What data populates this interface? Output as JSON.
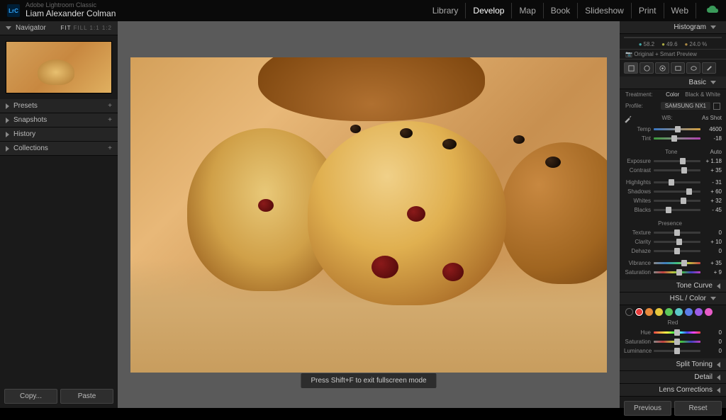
{
  "header": {
    "app_name": "Adobe Lightroom Classic",
    "user_name": "Liam Alexander Colman",
    "logo_text": "LrC",
    "modules": [
      "Library",
      "Develop",
      "Map",
      "Book",
      "Slideshow",
      "Print",
      "Web"
    ],
    "active_module": "Develop"
  },
  "left_panel": {
    "navigator": {
      "title": "Navigator",
      "options": "FIT  FILL  1:1  1:2",
      "active": "FIT"
    },
    "sections": [
      {
        "title": "Presets",
        "plus": "+"
      },
      {
        "title": "Snapshots",
        "plus": "+"
      },
      {
        "title": "History",
        "plus": ""
      },
      {
        "title": "Collections",
        "plus": "+"
      }
    ],
    "copy_btn": "Copy...",
    "paste_btn": "Paste"
  },
  "center": {
    "hint": "Press Shift+F to exit fullscreen mode"
  },
  "right_panel": {
    "histogram_title": "Histogram",
    "histo_stats": [
      "58.2",
      "49.6",
      "24.0 %"
    ],
    "preview_mode": "Original + Smart Preview",
    "basic": {
      "title": "Basic",
      "treatment_label": "Treatment:",
      "treatment_color": "Color",
      "treatment_bw": "Black & White",
      "profile_label": "Profile:",
      "profile_value": "SAMSUNG NX1",
      "wb_label": "WB:",
      "wb_value": "As Shot",
      "sliders_wb": [
        {
          "label": "Temp",
          "value": "4600",
          "pos": 52
        },
        {
          "label": "Tint",
          "value": "-18",
          "pos": 44
        }
      ],
      "tone_label": "Tone",
      "tone_auto": "Auto",
      "sliders_tone": [
        {
          "label": "Exposure",
          "value": "+ 1.18",
          "pos": 62
        },
        {
          "label": "Contrast",
          "value": "+ 35",
          "pos": 65
        }
      ],
      "sliders_tone2": [
        {
          "label": "Highlights",
          "value": "- 31",
          "pos": 38
        },
        {
          "label": "Shadows",
          "value": "+ 60",
          "pos": 75
        },
        {
          "label": "Whites",
          "value": "+ 32",
          "pos": 64
        },
        {
          "label": "Blacks",
          "value": "- 45",
          "pos": 32
        }
      ],
      "presence_label": "Presence",
      "sliders_presence": [
        {
          "label": "Texture",
          "value": "0",
          "pos": 50
        },
        {
          "label": "Clarity",
          "value": "+ 10",
          "pos": 55
        },
        {
          "label": "Dehaze",
          "value": "0",
          "pos": 50
        }
      ],
      "sliders_vib": [
        {
          "label": "Vibrance",
          "value": "+ 35",
          "pos": 65
        },
        {
          "label": "Saturation",
          "value": "+ 9",
          "pos": 54
        }
      ]
    },
    "panels_collapsed": [
      "Tone Curve"
    ],
    "hsl": {
      "title": "HSL / Color",
      "colors": [
        "#e73c3c",
        "#e78a3c",
        "#e7c83c",
        "#5cc85c",
        "#5cc8c8",
        "#5c7ce7",
        "#9c5ce7",
        "#e75cc8"
      ],
      "selected": 0,
      "active_label": "Red",
      "sliders": [
        {
          "label": "Hue",
          "value": "0",
          "pos": 50
        },
        {
          "label": "Saturation",
          "value": "0",
          "pos": 50
        },
        {
          "label": "Luminance",
          "value": "0",
          "pos": 50
        }
      ]
    },
    "panels_bottom": [
      "Split Toning",
      "Detail",
      "Lens Corrections"
    ],
    "previous_btn": "Previous",
    "reset_btn": "Reset"
  }
}
